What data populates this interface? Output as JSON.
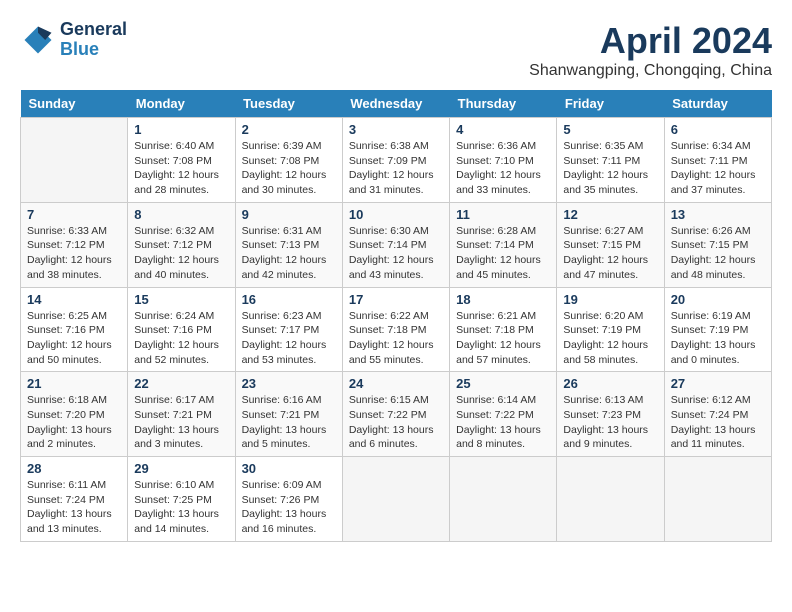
{
  "header": {
    "logo_line1": "General",
    "logo_line2": "Blue",
    "title": "April 2024",
    "subtitle": "Shanwangping, Chongqing, China"
  },
  "calendar": {
    "days_of_week": [
      "Sunday",
      "Monday",
      "Tuesday",
      "Wednesday",
      "Thursday",
      "Friday",
      "Saturday"
    ],
    "weeks": [
      [
        {
          "day": "",
          "info": ""
        },
        {
          "day": "1",
          "info": "Sunrise: 6:40 AM\nSunset: 7:08 PM\nDaylight: 12 hours and 28 minutes."
        },
        {
          "day": "2",
          "info": "Sunrise: 6:39 AM\nSunset: 7:08 PM\nDaylight: 12 hours and 30 minutes."
        },
        {
          "day": "3",
          "info": "Sunrise: 6:38 AM\nSunset: 7:09 PM\nDaylight: 12 hours and 31 minutes."
        },
        {
          "day": "4",
          "info": "Sunrise: 6:36 AM\nSunset: 7:10 PM\nDaylight: 12 hours and 33 minutes."
        },
        {
          "day": "5",
          "info": "Sunrise: 6:35 AM\nSunset: 7:11 PM\nDaylight: 12 hours and 35 minutes."
        },
        {
          "day": "6",
          "info": "Sunrise: 6:34 AM\nSunset: 7:11 PM\nDaylight: 12 hours and 37 minutes."
        }
      ],
      [
        {
          "day": "7",
          "info": "Sunrise: 6:33 AM\nSunset: 7:12 PM\nDaylight: 12 hours and 38 minutes."
        },
        {
          "day": "8",
          "info": "Sunrise: 6:32 AM\nSunset: 7:12 PM\nDaylight: 12 hours and 40 minutes."
        },
        {
          "day": "9",
          "info": "Sunrise: 6:31 AM\nSunset: 7:13 PM\nDaylight: 12 hours and 42 minutes."
        },
        {
          "day": "10",
          "info": "Sunrise: 6:30 AM\nSunset: 7:14 PM\nDaylight: 12 hours and 43 minutes."
        },
        {
          "day": "11",
          "info": "Sunrise: 6:28 AM\nSunset: 7:14 PM\nDaylight: 12 hours and 45 minutes."
        },
        {
          "day": "12",
          "info": "Sunrise: 6:27 AM\nSunset: 7:15 PM\nDaylight: 12 hours and 47 minutes."
        },
        {
          "day": "13",
          "info": "Sunrise: 6:26 AM\nSunset: 7:15 PM\nDaylight: 12 hours and 48 minutes."
        }
      ],
      [
        {
          "day": "14",
          "info": "Sunrise: 6:25 AM\nSunset: 7:16 PM\nDaylight: 12 hours and 50 minutes."
        },
        {
          "day": "15",
          "info": "Sunrise: 6:24 AM\nSunset: 7:16 PM\nDaylight: 12 hours and 52 minutes."
        },
        {
          "day": "16",
          "info": "Sunrise: 6:23 AM\nSunset: 7:17 PM\nDaylight: 12 hours and 53 minutes."
        },
        {
          "day": "17",
          "info": "Sunrise: 6:22 AM\nSunset: 7:18 PM\nDaylight: 12 hours and 55 minutes."
        },
        {
          "day": "18",
          "info": "Sunrise: 6:21 AM\nSunset: 7:18 PM\nDaylight: 12 hours and 57 minutes."
        },
        {
          "day": "19",
          "info": "Sunrise: 6:20 AM\nSunset: 7:19 PM\nDaylight: 12 hours and 58 minutes."
        },
        {
          "day": "20",
          "info": "Sunrise: 6:19 AM\nSunset: 7:19 PM\nDaylight: 13 hours and 0 minutes."
        }
      ],
      [
        {
          "day": "21",
          "info": "Sunrise: 6:18 AM\nSunset: 7:20 PM\nDaylight: 13 hours and 2 minutes."
        },
        {
          "day": "22",
          "info": "Sunrise: 6:17 AM\nSunset: 7:21 PM\nDaylight: 13 hours and 3 minutes."
        },
        {
          "day": "23",
          "info": "Sunrise: 6:16 AM\nSunset: 7:21 PM\nDaylight: 13 hours and 5 minutes."
        },
        {
          "day": "24",
          "info": "Sunrise: 6:15 AM\nSunset: 7:22 PM\nDaylight: 13 hours and 6 minutes."
        },
        {
          "day": "25",
          "info": "Sunrise: 6:14 AM\nSunset: 7:22 PM\nDaylight: 13 hours and 8 minutes."
        },
        {
          "day": "26",
          "info": "Sunrise: 6:13 AM\nSunset: 7:23 PM\nDaylight: 13 hours and 9 minutes."
        },
        {
          "day": "27",
          "info": "Sunrise: 6:12 AM\nSunset: 7:24 PM\nDaylight: 13 hours and 11 minutes."
        }
      ],
      [
        {
          "day": "28",
          "info": "Sunrise: 6:11 AM\nSunset: 7:24 PM\nDaylight: 13 hours and 13 minutes."
        },
        {
          "day": "29",
          "info": "Sunrise: 6:10 AM\nSunset: 7:25 PM\nDaylight: 13 hours and 14 minutes."
        },
        {
          "day": "30",
          "info": "Sunrise: 6:09 AM\nSunset: 7:26 PM\nDaylight: 13 hours and 16 minutes."
        },
        {
          "day": "",
          "info": ""
        },
        {
          "day": "",
          "info": ""
        },
        {
          "day": "",
          "info": ""
        },
        {
          "day": "",
          "info": ""
        }
      ]
    ]
  }
}
